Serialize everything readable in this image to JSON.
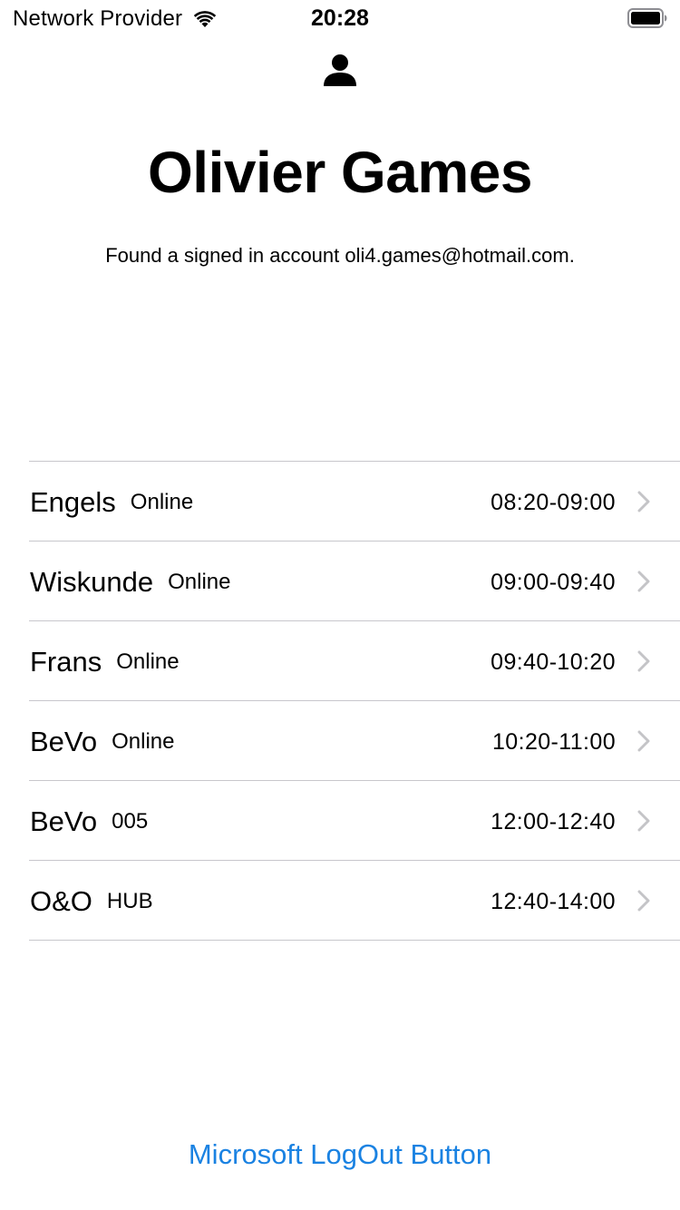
{
  "status_bar": {
    "carrier": "Network Provider",
    "time": "20:28",
    "icons": [
      "wifi-icon",
      "battery-icon"
    ]
  },
  "header": {
    "icon": "person-icon",
    "title": "Olivier Games",
    "subtitle": "Found a signed in account oli4.games@hotmail.com."
  },
  "schedule": [
    {
      "subject": "Engels",
      "location": "Online",
      "time": "08:20-09:00"
    },
    {
      "subject": "Wiskunde",
      "location": "Online",
      "time": "09:00-09:40"
    },
    {
      "subject": "Frans",
      "location": "Online",
      "time": "09:40-10:20"
    },
    {
      "subject": "BeVo",
      "location": "Online",
      "time": "10:20-11:00"
    },
    {
      "subject": "BeVo",
      "location": "005",
      "time": "12:00-12:40"
    },
    {
      "subject": "O&O",
      "location": "HUB",
      "time": "12:40-14:00"
    }
  ],
  "footer": {
    "logout_label": "Microsoft LogOut Button"
  },
  "colors": {
    "accent": "#1a82e2",
    "separator": "#c8c7cc",
    "chevron": "#c4c4c7"
  }
}
